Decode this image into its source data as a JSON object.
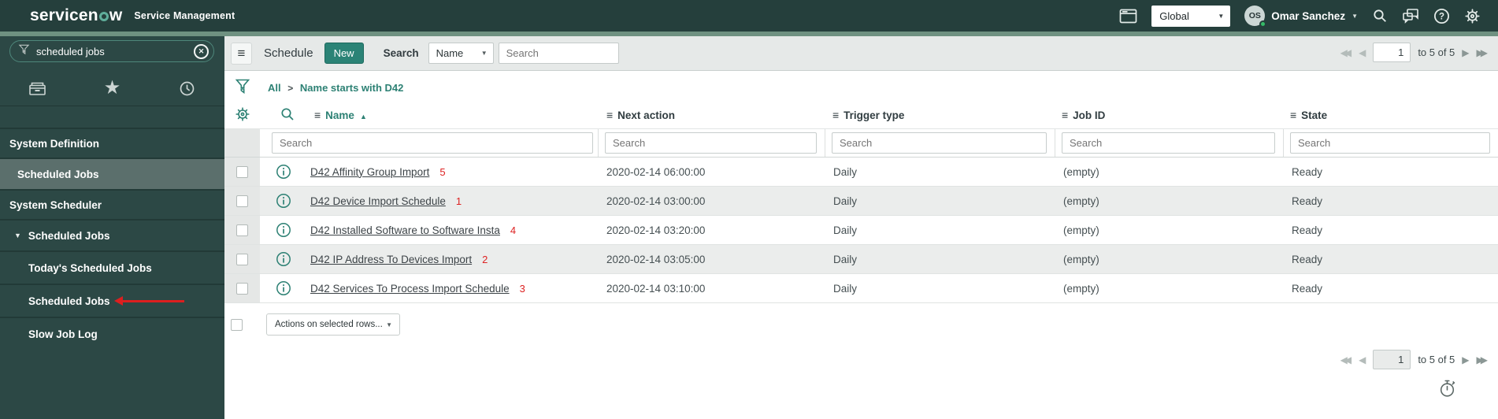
{
  "colors": {
    "accent_teal": "#2d8174",
    "banner_bg": "#253f3c",
    "new_button_bg": "#2b8376",
    "annotation_red": "#dd2222",
    "selected_nav_bg": "#5b6f6c"
  },
  "header": {
    "logo_part1": "servicen",
    "logo_part2": "w",
    "product": "Service Management",
    "scope": "Global",
    "user_initials": "OS",
    "user_name": "Omar Sanchez"
  },
  "sidebar": {
    "search_value": "scheduled jobs",
    "items": [
      {
        "label": "System Definition"
      },
      {
        "label": "Scheduled Jobs"
      },
      {
        "label": "System Scheduler"
      },
      {
        "label": "Scheduled Jobs"
      },
      {
        "label": "Today's Scheduled Jobs"
      },
      {
        "label": "Scheduled Jobs"
      },
      {
        "label": "Slow Job Log"
      }
    ]
  },
  "toolbar": {
    "title": "Schedule",
    "new_label": "New",
    "search_label": "Search",
    "field_selector": "Name",
    "search_placeholder": "Search"
  },
  "pagination": {
    "page": "1",
    "range": "to 5 of 5"
  },
  "breadcrumb": {
    "root": "All",
    "separator": ">",
    "filter": "Name starts with D42"
  },
  "table": {
    "filter_placeholder": "Search",
    "columns": [
      {
        "label": "Name"
      },
      {
        "label": "Next action"
      },
      {
        "label": "Trigger type"
      },
      {
        "label": "Job ID"
      },
      {
        "label": "State"
      }
    ],
    "rows": [
      {
        "name": "D42 Affinity Group Import",
        "annotation": "5",
        "next_action": "2020-02-14 06:00:00",
        "trigger_type": "Daily",
        "job_id": "(empty)",
        "state": "Ready"
      },
      {
        "name": "D42 Device Import Schedule",
        "annotation": "1",
        "next_action": "2020-02-14 03:00:00",
        "trigger_type": "Daily",
        "job_id": "(empty)",
        "state": "Ready"
      },
      {
        "name": "D42 Installed Software to Software Insta",
        "annotation": "4",
        "next_action": "2020-02-14 03:20:00",
        "trigger_type": "Daily",
        "job_id": "(empty)",
        "state": "Ready"
      },
      {
        "name": "D42 IP Address To Devices Import",
        "annotation": "2",
        "next_action": "2020-02-14 03:05:00",
        "trigger_type": "Daily",
        "job_id": "(empty)",
        "state": "Ready"
      },
      {
        "name": "D42 Services To Process Import Schedule",
        "annotation": "3",
        "next_action": "2020-02-14 03:10:00",
        "trigger_type": "Daily",
        "job_id": "(empty)",
        "state": "Ready"
      }
    ],
    "actions_label": "Actions on selected rows..."
  }
}
